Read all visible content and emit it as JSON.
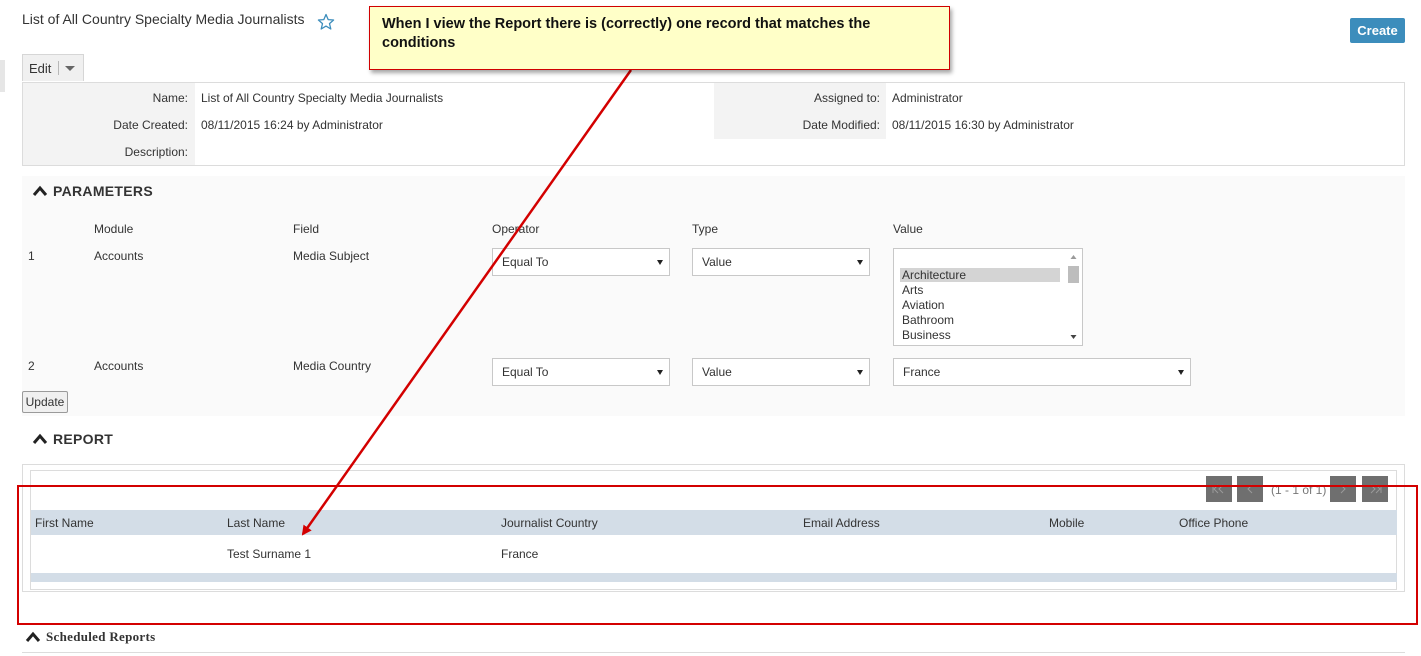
{
  "header": {
    "title": "List of All Country Specialty Media Journalists",
    "create_label": "Create"
  },
  "edit": {
    "label": "Edit"
  },
  "detail": {
    "name_label": "Name:",
    "name_value": "List of All Country Specialty Media Journalists",
    "date_created_label": "Date Created:",
    "date_created_value": "08/11/2015 16:24 by Administrator",
    "description_label": "Description:",
    "description_value": "",
    "assigned_label": "Assigned to:",
    "assigned_value": "Administrator",
    "date_modified_label": "Date Modified:",
    "date_modified_value": "08/11/2015 16:30 by Administrator"
  },
  "parameters": {
    "title": "PARAMETERS",
    "columns": [
      "Module",
      "Field",
      "Operator",
      "Type",
      "Value"
    ],
    "rows": [
      {
        "num": "1",
        "module": "Accounts",
        "field": "Media Subject",
        "operator": "Equal To",
        "type": "Value",
        "value_options": [
          "Architecture",
          "Arts",
          "Aviation",
          "Bathroom",
          "Business"
        ],
        "value_selected": "Architecture"
      },
      {
        "num": "2",
        "module": "Accounts",
        "field": "Media Country",
        "operator": "Equal To",
        "type": "Value",
        "value": "France"
      }
    ],
    "update_label": "Update"
  },
  "report": {
    "title": "REPORT",
    "pager_text": "(1 - 1 of 1)",
    "columns": [
      "First Name",
      "Last Name",
      "Journalist Country",
      "Email Address",
      "Mobile",
      "Office Phone"
    ],
    "rows": [
      {
        "first_name": "",
        "last_name": "Test Surname 1",
        "journalist_country": "France",
        "email": "",
        "mobile": "",
        "office_phone": ""
      }
    ]
  },
  "scheduled": {
    "title": "Scheduled Reports"
  },
  "annotation": {
    "text": "When I view the Report there is (correctly) one record that matches the conditions",
    "color": "#d30000",
    "background": "#ffffc8"
  },
  "colors": {
    "accent": "#3c8dbc",
    "table_header": "#d3dde7"
  },
  "icons": {
    "favorite": "star-outline-icon",
    "collapse": "chevron-up-icon",
    "dropdown": "caret-down-icon",
    "pager": [
      "first-page-icon",
      "previous-page-icon",
      "next-page-icon",
      "last-page-icon"
    ]
  }
}
